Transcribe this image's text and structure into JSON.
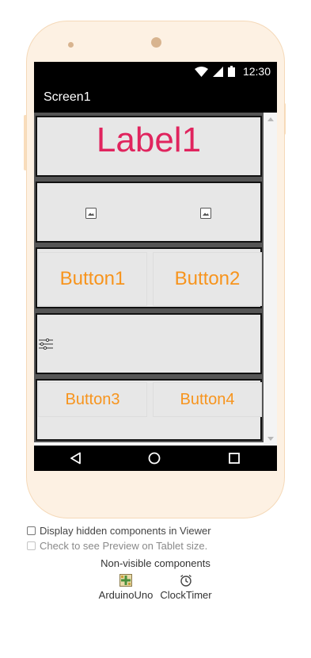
{
  "status_bar": {
    "time": "12:30",
    "icons": [
      "wifi-icon",
      "signal-icon",
      "battery-icon"
    ]
  },
  "screen": {
    "title": "Screen1"
  },
  "components": {
    "label1": {
      "text": "Label1",
      "color": "#e0245e"
    },
    "images": [
      "image-icon",
      "image-icon"
    ],
    "button1": "Button1",
    "button2": "Button2",
    "slider_icon": "slider-icon",
    "button3": "Button3",
    "button4": "Button4",
    "button_text_color": "#f7941d"
  },
  "nav_bar": {
    "icons": [
      "back-icon",
      "home-icon",
      "recents-icon"
    ]
  },
  "options": {
    "display_hidden": "Display hidden components in Viewer",
    "tablet_preview": "Check to see Preview on Tablet size."
  },
  "non_visible": {
    "title": "Non-visible components",
    "items": [
      {
        "label": "ArduinoUno",
        "icon": "arduino-icon"
      },
      {
        "label": "ClockTimer",
        "icon": "clock-icon"
      }
    ]
  },
  "colors": {
    "phone_shell": "#fdf1e3",
    "arrangement_bg": "#e7e7e7"
  }
}
